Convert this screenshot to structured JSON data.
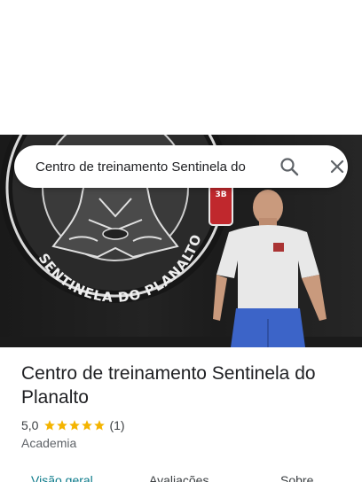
{
  "search": {
    "query": "Centro de treinamento Sentinela do",
    "search_icon": "search-icon",
    "close_icon": "close-icon"
  },
  "hero": {
    "wall_text": "SENTINELA DO PLANALTO",
    "badge_text": "3B"
  },
  "place": {
    "title": "Centro de treinamento Sentinela do Planalto",
    "rating": "5,0",
    "stars": 5,
    "review_count": "(1)",
    "category": "Academia"
  },
  "tabs": [
    {
      "label": "Visão geral",
      "active": true
    },
    {
      "label": "Avaliações",
      "active": false
    },
    {
      "label": "Sobre",
      "active": false
    }
  ],
  "colors": {
    "star": "#f4b400",
    "active_tab": "#0b7a8a",
    "text": "#202124"
  }
}
